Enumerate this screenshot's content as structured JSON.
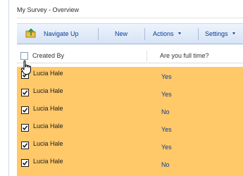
{
  "page": {
    "title": "My Survey - Overview"
  },
  "toolbar": {
    "navigate_up": "Navigate Up",
    "new": "New",
    "actions": "Actions",
    "settings": "Settings"
  },
  "list": {
    "columns": [
      "Created By",
      "Are you full time?"
    ],
    "rows": [
      {
        "created_by": "Lucia Hale",
        "answer": "Yes",
        "checked": true
      },
      {
        "created_by": "Lucia Hale",
        "answer": "Yes",
        "checked": true
      },
      {
        "created_by": "Lucia Hale",
        "answer": "No",
        "checked": true
      },
      {
        "created_by": "Lucia Hale",
        "answer": "Yes",
        "checked": true
      },
      {
        "created_by": "Lucia Hale",
        "answer": "Yes",
        "checked": true
      },
      {
        "created_by": "Lucia Hale",
        "answer": "No",
        "checked": true
      }
    ]
  },
  "colors": {
    "selected_row": "#ffc869",
    "toolbar_text": "#0b3d91",
    "toolbar_bg": "#d6e3f5"
  },
  "icons": {
    "navigate_up": "folder-up-arrow-icon",
    "cursor": "hand-pointer-cursor-icon"
  }
}
